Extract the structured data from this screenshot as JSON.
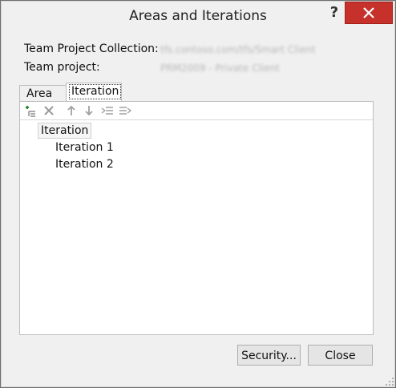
{
  "window": {
    "title": "Areas and Iterations",
    "help_label": "?"
  },
  "info": {
    "collection_label": "Team Project Collection:",
    "collection_value": "tfs.contoso.com/tfs/Smart Client",
    "project_label": "Team project:",
    "project_value": "PRM2009 - Private Client"
  },
  "tabs": [
    {
      "label": "Area",
      "selected": false
    },
    {
      "label": "Iteration",
      "selected": true
    }
  ],
  "toolbar": {
    "icons": [
      "add-node-icon",
      "delete-icon",
      "move-up-icon",
      "move-down-icon",
      "outdent-icon",
      "indent-icon"
    ]
  },
  "tree": {
    "root": "Iteration",
    "children": [
      "Iteration 1",
      "Iteration 2"
    ]
  },
  "buttons": {
    "security": "Security...",
    "close": "Close"
  },
  "colors": {
    "close_button": "#c7312b",
    "window_bg": "#f0f0f0",
    "panel_bg": "#ffffff"
  }
}
